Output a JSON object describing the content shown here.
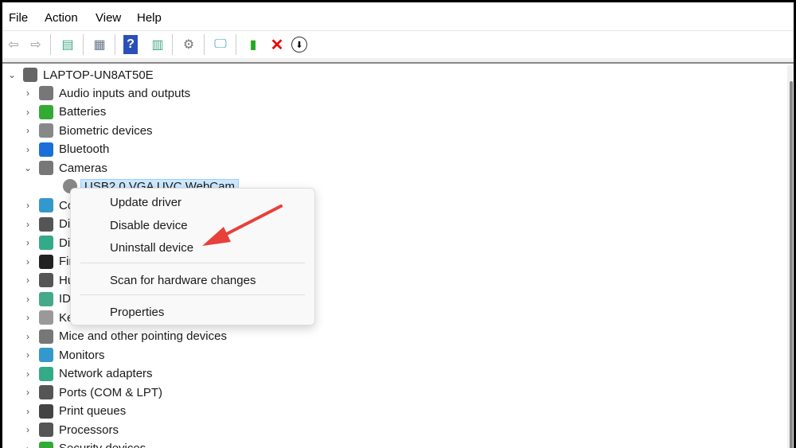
{
  "menu": [
    "File",
    "Action",
    "View",
    "Help"
  ],
  "toolbar": [
    "back-icon",
    "forward-icon",
    "show-hide-console-tree-icon",
    "properties-icon",
    "help-icon",
    "show-action-pane-icon",
    "update-driver-icon",
    "scan-hardware-icon",
    "enable-device-icon",
    "uninstall-device-icon",
    "disable-device-icon"
  ],
  "tree": {
    "root": "LAPTOP-UN8AT50E",
    "items": [
      "Audio inputs and outputs",
      "Batteries",
      "Biometric devices",
      "Bluetooth",
      "Cameras"
    ],
    "selected": "USB2.0 VGA UVC WebCam",
    "items2": [
      "Computer",
      "Disk drives",
      "Display adapters",
      "Firmware",
      "Human Interface Devices",
      "IDE ATA/ATAPI controllers",
      "Keyboards",
      "Mice and other pointing devices",
      "Monitors",
      "Network adapters",
      "Ports (COM & LPT)",
      "Print queues",
      "Processors",
      "Security devices"
    ]
  },
  "context_menu": {
    "update": "Update driver",
    "disable": "Disable device",
    "uninstall": "Uninstall device",
    "scan": "Scan for hardware changes",
    "properties": "Properties"
  },
  "colors": {
    "arrow": "#e8403a",
    "selection": "#cce8ff"
  }
}
